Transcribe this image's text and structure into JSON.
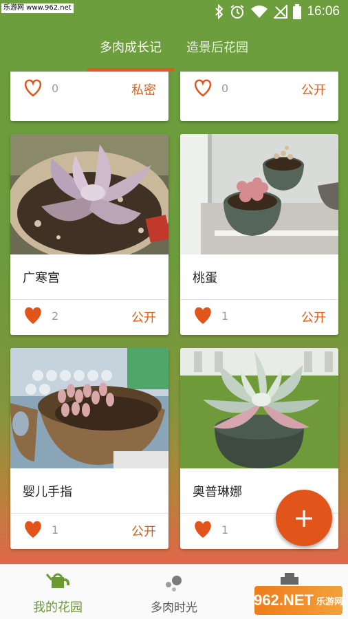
{
  "status_bar": {
    "watermark": "乐游网 www.962.net",
    "time": "16:06"
  },
  "tabs": [
    {
      "label": "多肉成长记",
      "active": true
    },
    {
      "label": "造景后花园",
      "active": false
    }
  ],
  "cards": [
    {
      "title": "",
      "likes": "0",
      "visibility": "私密",
      "liked": false
    },
    {
      "title": "",
      "likes": "0",
      "visibility": "公开",
      "liked": false
    },
    {
      "title": "广寒宫",
      "likes": "2",
      "visibility": "公开",
      "liked": true
    },
    {
      "title": "桃蛋",
      "likes": "1",
      "visibility": "公开",
      "liked": true
    },
    {
      "title": "婴儿手指",
      "likes": "1",
      "visibility": "公开",
      "liked": true
    },
    {
      "title": "奥普琳娜",
      "likes": "1",
      "visibility": "",
      "liked": true
    }
  ],
  "fab": {
    "label": "+"
  },
  "bottom_nav": [
    {
      "label": "我的花园",
      "icon": "watering-can-icon",
      "active": true
    },
    {
      "label": "多肉时光",
      "icon": "dots-icon",
      "active": false
    },
    {
      "label": "",
      "icon": "shop-icon",
      "active": false
    }
  ],
  "bottom_watermark": {
    "logo": "962.NET",
    "sub": "乐游网"
  },
  "colors": {
    "accent": "#e1551a",
    "brand_green": "#6a9a30",
    "header_green": "#6d9e3d"
  }
}
